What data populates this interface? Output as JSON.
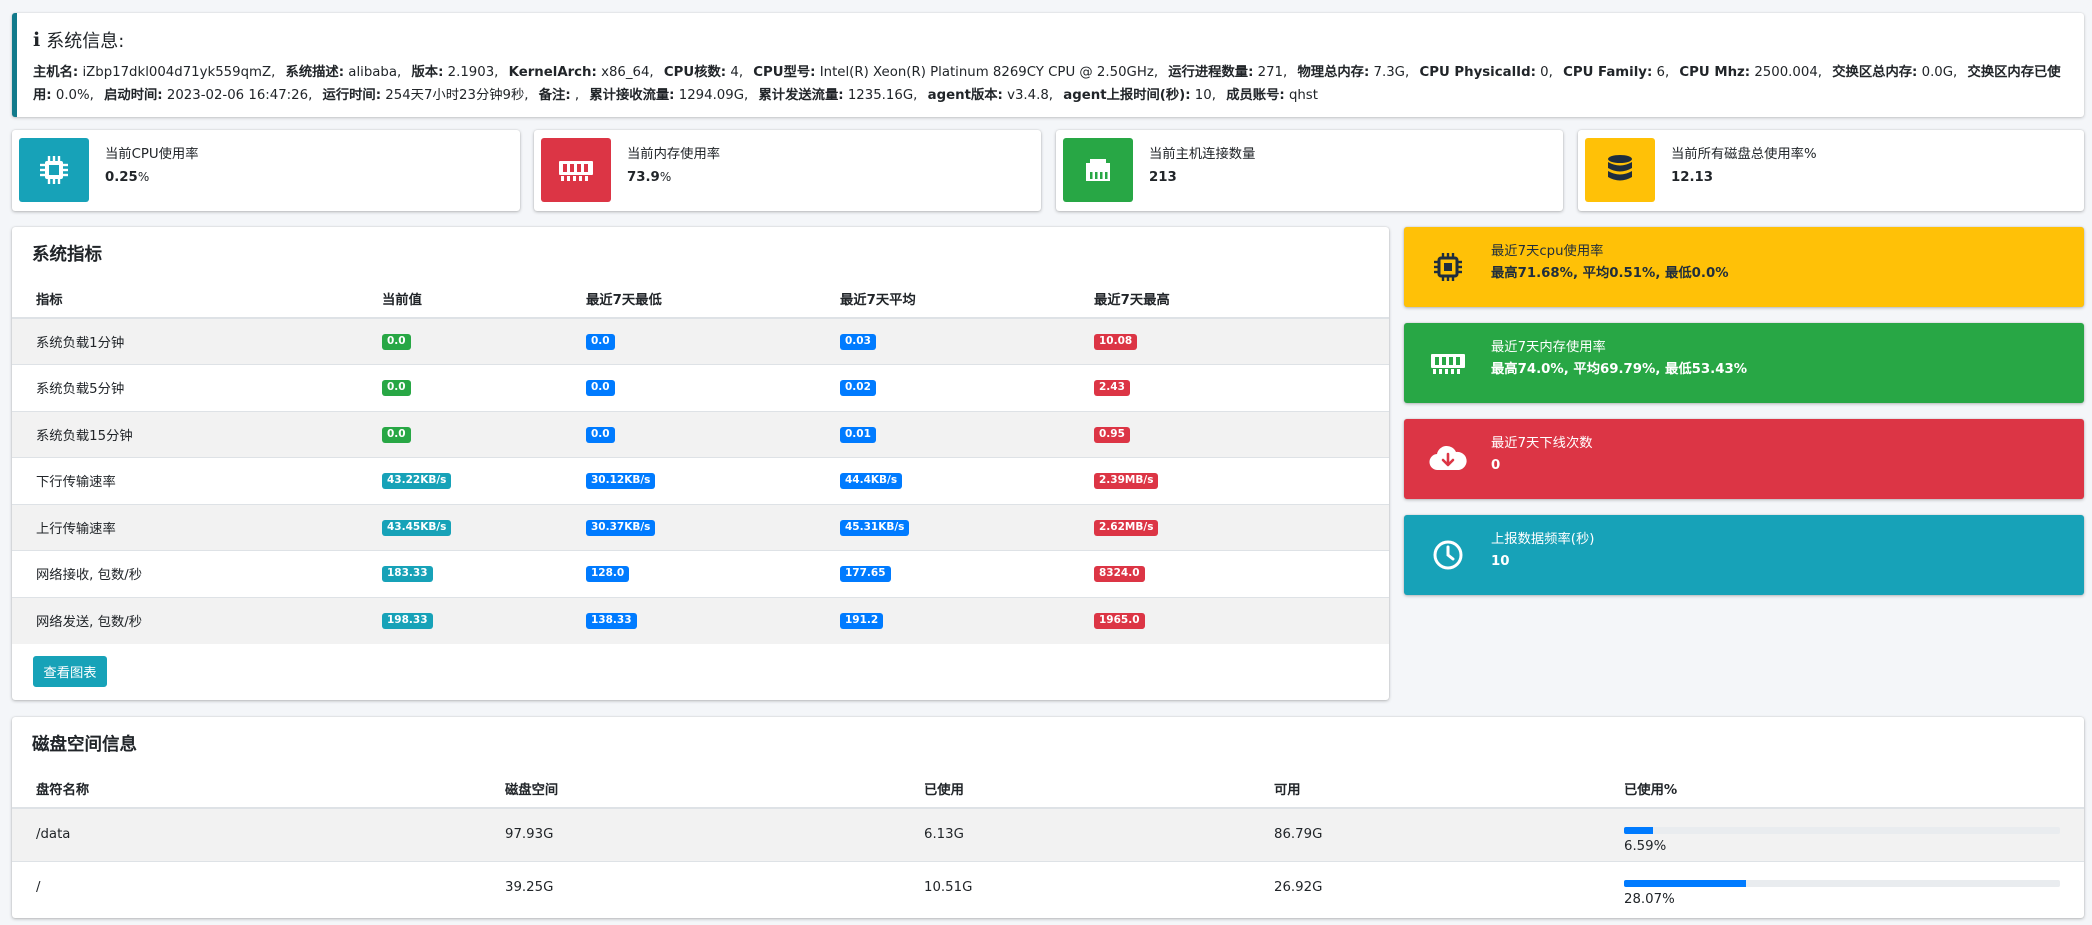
{
  "sysinfo": {
    "title": "系统信息:",
    "icon": "info-icon",
    "fields": [
      {
        "k": "主机名:",
        "v": "iZbp17dkl004d71yk559qmZ,"
      },
      {
        "k": "系统描述:",
        "v": "alibaba,"
      },
      {
        "k": "版本:",
        "v": "2.1903,"
      },
      {
        "k": "KernelArch:",
        "v": "x86_64,"
      },
      {
        "k": "CPU核数:",
        "v": "4,"
      },
      {
        "k": "CPU型号:",
        "v": "Intel(R) Xeon(R) Platinum 8269CY CPU @ 2.50GHz,"
      },
      {
        "k": "运行进程数量:",
        "v": "271,"
      },
      {
        "k": "物理总内存:",
        "v": "7.3G,"
      },
      {
        "k": "CPU PhysicalId:",
        "v": "0,"
      },
      {
        "k": "CPU Family:",
        "v": "6,"
      },
      {
        "k": "CPU Mhz:",
        "v": "2500.004,"
      },
      {
        "k": "交换区总内存:",
        "v": "0.0G,"
      },
      {
        "k": "交换区内存已使用:",
        "v": "0.0%,"
      },
      {
        "k": "启动时间:",
        "v": "2023-02-06 16:47:26,"
      },
      {
        "k": "运行时间:",
        "v": "254天7小时23分钟9秒,"
      },
      {
        "k": "备注:",
        "v": ","
      },
      {
        "k": "累计接收流量:",
        "v": "1294.09G,"
      },
      {
        "k": "累计发送流量:",
        "v": "1235.16G,"
      },
      {
        "k": "agent版本:",
        "v": "v3.4.8,"
      },
      {
        "k": "agent上报时间(秒):",
        "v": "10,"
      },
      {
        "k": "成员账号:",
        "v": "qhst"
      }
    ]
  },
  "info_boxes": [
    {
      "label": "当前CPU使用率",
      "value": "0.25",
      "unit": "%",
      "icon": "cpu-chip-icon",
      "color": "#17a2b8"
    },
    {
      "label": "当前内存使用率",
      "value": "73.9",
      "unit": "%",
      "icon": "memory-icon",
      "color": "#dc3545"
    },
    {
      "label": "当前主机连接数量",
      "value": "213",
      "unit": "",
      "icon": "ethernet-icon",
      "color": "#28a745"
    },
    {
      "label": "当前所有磁盘总使用率%",
      "value": "12.13",
      "unit": "",
      "icon": "database-icon",
      "color": "#ffc107"
    }
  ],
  "metrics": {
    "title": "系统指标",
    "columns": [
      "指标",
      "当前值",
      "最近7天最低",
      "最近7天平均",
      "最近7天最高"
    ],
    "rows": [
      {
        "name": "系统负载1分钟",
        "cur": "0.0",
        "min": "0.0",
        "avg": "0.03",
        "max": "10.08",
        "cur_style": "green"
      },
      {
        "name": "系统负载5分钟",
        "cur": "0.0",
        "min": "0.0",
        "avg": "0.02",
        "max": "2.43",
        "cur_style": "green"
      },
      {
        "name": "系统负载15分钟",
        "cur": "0.0",
        "min": "0.0",
        "avg": "0.01",
        "max": "0.95",
        "cur_style": "green"
      },
      {
        "name": "下行传输速率",
        "cur": "43.22KB/s",
        "min": "30.12KB/s",
        "avg": "44.4KB/s",
        "max": "2.39MB/s",
        "cur_style": "teal"
      },
      {
        "name": "上行传输速率",
        "cur": "43.45KB/s",
        "min": "30.37KB/s",
        "avg": "45.31KB/s",
        "max": "2.62MB/s",
        "cur_style": "teal"
      },
      {
        "name": "网络接收, 包数/秒",
        "cur": "183.33",
        "min": "128.0",
        "avg": "177.65",
        "max": "8324.0",
        "cur_style": "teal"
      },
      {
        "name": "网络发送, 包数/秒",
        "cur": "198.33",
        "min": "138.33",
        "avg": "191.2",
        "max": "1965.0",
        "cur_style": "teal"
      }
    ],
    "button_label": "查看图表"
  },
  "color_boxes": [
    {
      "label": "最近7天cpu使用率",
      "value": "最高71.68%, 平均0.51%, 最低0.0%",
      "icon": "cpu-chip-icon",
      "bg": "#ffc107",
      "fg": "#1f2d3d"
    },
    {
      "label": "最近7天内存使用率",
      "value": "最高74.0%, 平均69.79%, 最低53.43%",
      "icon": "memory-icon",
      "bg": "#28a745",
      "fg": "#ffffff"
    },
    {
      "label": "最近7天下线次数",
      "value": "0",
      "icon": "cloud-download-icon",
      "bg": "#dc3545",
      "fg": "#ffffff"
    },
    {
      "label": "上报数据频率(秒)",
      "value": "10",
      "icon": "clock-icon",
      "bg": "#17a2b8",
      "fg": "#ffffff"
    }
  ],
  "disk": {
    "title": "磁盘空间信息",
    "columns": [
      "盘符名称",
      "磁盘空间",
      "已使用",
      "可用",
      "已使用%"
    ],
    "rows": [
      {
        "name": "/data",
        "size": "97.93G",
        "used": "6.13G",
        "avail": "86.79G",
        "pct": "6.59%",
        "pct_value": 6.59
      },
      {
        "name": "/",
        "size": "39.25G",
        "used": "10.51G",
        "avail": "26.92G",
        "pct": "28.07%",
        "pct_value": 28.07
      }
    ]
  }
}
